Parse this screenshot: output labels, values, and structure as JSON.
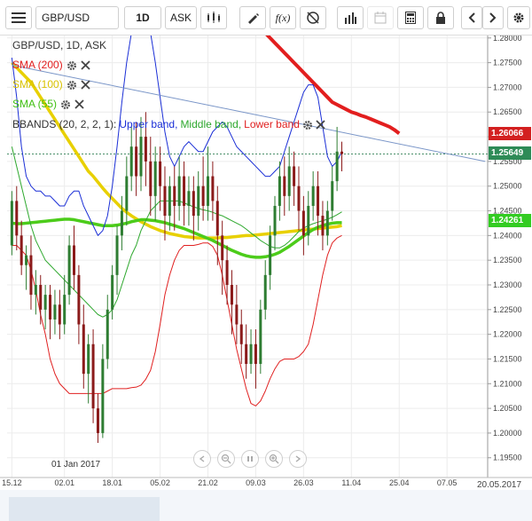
{
  "toolbar": {
    "menu_icon": "hamburger-icon",
    "symbol": "GBP/USD",
    "timeframe": "1D",
    "side": "ASK",
    "icons": [
      "candlestick-icon",
      "draw-pen-icon",
      "formula-fx-icon",
      "no-alarm-icon",
      "bar-chart-icon",
      "calendar-icon",
      "calculator-icon",
      "lock-icon",
      "chevron-left-icon",
      "chevron-right-icon",
      "settings-gear-icon"
    ],
    "fx_label": "f(x)"
  },
  "legend": {
    "header": "GBP/USD, 1D, ASK",
    "sma200": "SMA (200)",
    "sma100": "SMA (100)",
    "sma55": "SMA (55)",
    "bbands_prefix": "BBANDS (20, 2, 2, 1):",
    "bbands_upper": "Upper band,",
    "bbands_middle": "Middle band,",
    "bbands_lower": "Lower band"
  },
  "colors": {
    "up": "#2e7d32",
    "down": "#8b1a1a",
    "sma200": "#e21e1e",
    "sma100": "#e8d000",
    "sma55": "#4ccc1a",
    "upper": "#1a2ed6",
    "middle": "#2ea82e",
    "lower": "#e02020",
    "trend": "#7a96c8",
    "price_tag_sma200": "#d32020",
    "price_tag_last": "#2e8b57",
    "price_tag_sma55": "#33cc22"
  },
  "price_tags": {
    "sma200": "1.26066",
    "last": "1.25649",
    "sma55": "1.24261"
  },
  "date_label": "01 Jan 2017",
  "footer_date": "20.05.2017",
  "chart_data": {
    "type": "candlestick",
    "symbol": "GBP/USD",
    "interval": "1D",
    "y_ticks": [
      "1.19500",
      "1.20000",
      "1.20500",
      "1.21000",
      "1.21500",
      "1.22000",
      "1.22500",
      "1.23000",
      "1.23500",
      "1.24000",
      "1.24500",
      "1.25000",
      "1.25500",
      "1.26000",
      "1.26500",
      "1.27000",
      "1.27500",
      "1.28000"
    ],
    "ylim": [
      1.191,
      1.2805
    ],
    "x_ticks": [
      "15.12",
      "02.01",
      "18.01",
      "05.02",
      "21.02",
      "09.03",
      "26.03",
      "11.04",
      "25.04",
      "07.05"
    ],
    "x_tick_index": [
      0,
      11,
      21,
      31,
      41,
      51,
      61,
      71,
      81,
      91
    ],
    "x_range": [
      -1,
      99.5
    ],
    "candles": [
      [
        1.238,
        1.247,
        1.249,
        1.236
      ],
      [
        1.247,
        1.24,
        1.25,
        1.237
      ],
      [
        1.24,
        1.234,
        1.243,
        1.232
      ],
      [
        1.234,
        1.236,
        1.238,
        1.229
      ],
      [
        1.236,
        1.228,
        1.24,
        1.225
      ],
      [
        1.228,
        1.23,
        1.233,
        1.224
      ],
      [
        1.23,
        1.225,
        1.232,
        1.222
      ],
      [
        1.225,
        1.228,
        1.23,
        1.221
      ],
      [
        1.228,
        1.223,
        1.23,
        1.219
      ],
      [
        1.223,
        1.226,
        1.229,
        1.22
      ],
      [
        1.226,
        1.222,
        1.229,
        1.219
      ],
      [
        1.222,
        1.228,
        1.232,
        1.22
      ],
      [
        1.228,
        1.238,
        1.24,
        1.226
      ],
      [
        1.238,
        1.232,
        1.242,
        1.229
      ],
      [
        1.232,
        1.222,
        1.234,
        1.218
      ],
      [
        1.222,
        1.212,
        1.226,
        1.209
      ],
      [
        1.212,
        1.218,
        1.22,
        1.206
      ],
      [
        1.218,
        1.205,
        1.221,
        1.202
      ],
      [
        1.205,
        1.2,
        1.208,
        1.198
      ],
      [
        1.2,
        1.215,
        1.218,
        1.199
      ],
      [
        1.215,
        1.225,
        1.228,
        1.213
      ],
      [
        1.225,
        1.232,
        1.234,
        1.223
      ],
      [
        1.232,
        1.24,
        1.242,
        1.228
      ],
      [
        1.24,
        1.245,
        1.248,
        1.237
      ],
      [
        1.245,
        1.252,
        1.256,
        1.242
      ],
      [
        1.252,
        1.258,
        1.262,
        1.249
      ],
      [
        1.258,
        1.252,
        1.263,
        1.248
      ],
      [
        1.252,
        1.26,
        1.264,
        1.249
      ],
      [
        1.26,
        1.255,
        1.265,
        1.25
      ],
      [
        1.255,
        1.248,
        1.26,
        1.244
      ],
      [
        1.248,
        1.255,
        1.258,
        1.243
      ],
      [
        1.255,
        1.25,
        1.258,
        1.245
      ],
      [
        1.25,
        1.244,
        1.254,
        1.239
      ],
      [
        1.244,
        1.25,
        1.252,
        1.241
      ],
      [
        1.25,
        1.246,
        1.254,
        1.241
      ],
      [
        1.246,
        1.252,
        1.256,
        1.243
      ],
      [
        1.252,
        1.246,
        1.255,
        1.242
      ],
      [
        1.246,
        1.249,
        1.252,
        1.242
      ],
      [
        1.249,
        1.244,
        1.252,
        1.239
      ],
      [
        1.244,
        1.25,
        1.253,
        1.241
      ],
      [
        1.25,
        1.246,
        1.256,
        1.243
      ],
      [
        1.246,
        1.252,
        1.258,
        1.243
      ],
      [
        1.252,
        1.247,
        1.255,
        1.243
      ],
      [
        1.247,
        1.24,
        1.25,
        1.234
      ],
      [
        1.24,
        1.235,
        1.243,
        1.228
      ],
      [
        1.235,
        1.23,
        1.238,
        1.226
      ],
      [
        1.23,
        1.226,
        1.233,
        1.22
      ],
      [
        1.226,
        1.222,
        1.23,
        1.218
      ],
      [
        1.222,
        1.218,
        1.225,
        1.214
      ],
      [
        1.218,
        1.214,
        1.222,
        1.211
      ],
      [
        1.214,
        1.218,
        1.221,
        1.212
      ],
      [
        1.218,
        1.214,
        1.221,
        1.209
      ],
      [
        1.214,
        1.225,
        1.227,
        1.212
      ],
      [
        1.225,
        1.232,
        1.235,
        1.223
      ],
      [
        1.232,
        1.24,
        1.242,
        1.229
      ],
      [
        1.24,
        1.246,
        1.248,
        1.237
      ],
      [
        1.246,
        1.252,
        1.255,
        1.243
      ],
      [
        1.252,
        1.248,
        1.256,
        1.244
      ],
      [
        1.248,
        1.254,
        1.258,
        1.245
      ],
      [
        1.254,
        1.25,
        1.257,
        1.246
      ],
      [
        1.25,
        1.245,
        1.254,
        1.241
      ],
      [
        1.245,
        1.24,
        1.248,
        1.236
      ],
      [
        1.24,
        1.246,
        1.249,
        1.238
      ],
      [
        1.246,
        1.25,
        1.253,
        1.243
      ],
      [
        1.25,
        1.244,
        1.253,
        1.24
      ],
      [
        1.244,
        1.24,
        1.247,
        1.237
      ],
      [
        1.24,
        1.245,
        1.247,
        1.238
      ],
      [
        1.245,
        1.251,
        1.254,
        1.243
      ],
      [
        1.251,
        1.257,
        1.262,
        1.249
      ],
      [
        1.257,
        1.2565,
        1.259,
        1.253
      ]
    ],
    "overlays": [
      {
        "name": "SMA (200)",
        "role": "sma200",
        "start": 49,
        "values": [
          1.285,
          1.284,
          1.283,
          1.282,
          1.281,
          1.28,
          1.279,
          1.278,
          1.277,
          1.276,
          1.275,
          1.274,
          1.273,
          1.272,
          1.271,
          1.27,
          1.269,
          1.268,
          1.267,
          1.2665,
          1.266,
          1.2655,
          1.265,
          1.2647,
          1.2643,
          1.264,
          1.2636,
          1.2632,
          1.2628,
          1.2624,
          1.262,
          1.2614,
          1.26066
        ]
      },
      {
        "name": "SMA (100)",
        "role": "sma100",
        "start": 0,
        "values": [
          1.275,
          1.274,
          1.273,
          1.272,
          1.271,
          1.2695,
          1.268,
          1.2665,
          1.265,
          1.2635,
          1.262,
          1.2605,
          1.259,
          1.2575,
          1.256,
          1.2545,
          1.253,
          1.252,
          1.2508,
          1.2496,
          1.2485,
          1.2475,
          1.2465,
          1.2455,
          1.2447,
          1.244,
          1.2434,
          1.2428,
          1.2423,
          1.2418,
          1.2414,
          1.241,
          1.2407,
          1.2404,
          1.2402,
          1.24,
          1.2398,
          1.2397,
          1.2396,
          1.2395,
          1.2395,
          1.2395,
          1.2395,
          1.2395,
          1.2396,
          1.2396,
          1.2397,
          1.2398,
          1.2399,
          1.24,
          1.24,
          1.2401,
          1.2402,
          1.2403,
          1.2404,
          1.2405,
          1.2406,
          1.2407,
          1.2408,
          1.2409,
          1.241,
          1.2411,
          1.2412,
          1.2413,
          1.2414,
          1.2415,
          1.2416,
          1.2417,
          1.2418,
          1.242
        ]
      },
      {
        "name": "SMA (55)",
        "role": "sma55",
        "start": 0,
        "values": [
          1.2425,
          1.2424,
          1.2424,
          1.2425,
          1.2426,
          1.2427,
          1.2428,
          1.2429,
          1.243,
          1.2431,
          1.2432,
          1.2433,
          1.2433,
          1.2432,
          1.243,
          1.2428,
          1.2426,
          1.2424,
          1.2422,
          1.242,
          1.242,
          1.242,
          1.2421,
          1.2423,
          1.2425,
          1.2428,
          1.243,
          1.2432,
          1.2432,
          1.2431,
          1.243,
          1.2428,
          1.2426,
          1.2423,
          1.242,
          1.2417,
          1.2414,
          1.241,
          1.2406,
          1.2402,
          1.2398,
          1.2394,
          1.239,
          1.2385,
          1.238,
          1.2375,
          1.237,
          1.2366,
          1.2362,
          1.2359,
          1.2357,
          1.2356,
          1.2356,
          1.2357,
          1.2359,
          1.2362,
          1.2366,
          1.2372,
          1.2378,
          1.2385,
          1.2392,
          1.2399,
          1.2406,
          1.2412,
          1.2417,
          1.242,
          1.2423,
          1.2425,
          1.2426,
          1.2426
        ]
      },
      {
        "name": "Upper band",
        "role": "upper",
        "start": 0,
        "values": [
          1.276,
          1.268,
          1.258,
          1.252,
          1.25,
          1.249,
          1.249,
          1.248,
          1.248,
          1.247,
          1.246,
          1.246,
          1.248,
          1.249,
          1.249,
          1.246,
          1.244,
          1.242,
          1.24,
          1.241,
          1.244,
          1.25,
          1.258,
          1.267,
          1.275,
          1.281,
          1.286,
          1.286,
          1.284,
          1.281,
          1.275,
          1.268,
          1.261,
          1.256,
          1.254,
          1.256,
          1.258,
          1.259,
          1.258,
          1.257,
          1.257,
          1.259,
          1.261,
          1.262,
          1.263,
          1.262,
          1.26,
          1.258,
          1.257,
          1.256,
          1.255,
          1.254,
          1.253,
          1.252,
          1.252,
          1.253,
          1.254,
          1.257,
          1.26,
          1.263,
          1.266,
          1.269,
          1.2705,
          1.2705,
          1.268,
          1.262,
          1.256,
          1.254,
          1.255,
          1.257
        ]
      },
      {
        "name": "Middle band",
        "role": "middle",
        "start": 0,
        "values": [
          1.258,
          1.254,
          1.25,
          1.246,
          1.242,
          1.239,
          1.237,
          1.235,
          1.234,
          1.233,
          1.232,
          1.231,
          1.23,
          1.229,
          1.228,
          1.227,
          1.226,
          1.225,
          1.224,
          1.2235,
          1.224,
          1.225,
          1.227,
          1.23,
          1.233,
          1.236,
          1.238,
          1.241,
          1.243,
          1.245,
          1.246,
          1.247,
          1.247,
          1.247,
          1.247,
          1.247,
          1.2466,
          1.2462,
          1.2458,
          1.2455,
          1.2452,
          1.245,
          1.2447,
          1.2443,
          1.244,
          1.2435,
          1.243,
          1.2425,
          1.242,
          1.2413,
          1.2405,
          1.2398,
          1.239,
          1.2384,
          1.2378,
          1.2375,
          1.2375,
          1.238,
          1.2388,
          1.2398,
          1.2408,
          1.2415,
          1.242,
          1.2424,
          1.2427,
          1.243,
          1.2433,
          1.2437,
          1.2442,
          1.2448
        ]
      },
      {
        "name": "Lower band",
        "role": "lower",
        "start": 0,
        "values": [
          1.238,
          1.238,
          1.237,
          1.236,
          1.233,
          1.229,
          1.224,
          1.22,
          1.215,
          1.212,
          1.21,
          1.209,
          1.208,
          1.208,
          1.208,
          1.208,
          1.208,
          1.208,
          1.208,
          1.208,
          1.2085,
          1.209,
          1.209,
          1.209,
          1.209,
          1.2092,
          1.2093,
          1.2097,
          1.2109,
          1.2127,
          1.2165,
          1.222,
          1.228,
          1.232,
          1.235,
          1.237,
          1.238,
          1.238,
          1.238,
          1.2382,
          1.2385,
          1.2385,
          1.2378,
          1.236,
          1.232,
          1.227,
          1.222,
          1.217,
          1.213,
          1.209,
          1.206,
          1.2055,
          1.2065,
          1.2085,
          1.211,
          1.213,
          1.2145,
          1.215,
          1.215,
          1.215,
          1.2155,
          1.2165,
          1.218,
          1.222,
          1.227,
          1.232,
          1.236,
          1.2385,
          1.2395,
          1.24
        ]
      },
      {
        "name": "trendline",
        "role": "trend",
        "start": 0,
        "values": [
          1.2745,
          1.2722
        ]
      }
    ]
  }
}
